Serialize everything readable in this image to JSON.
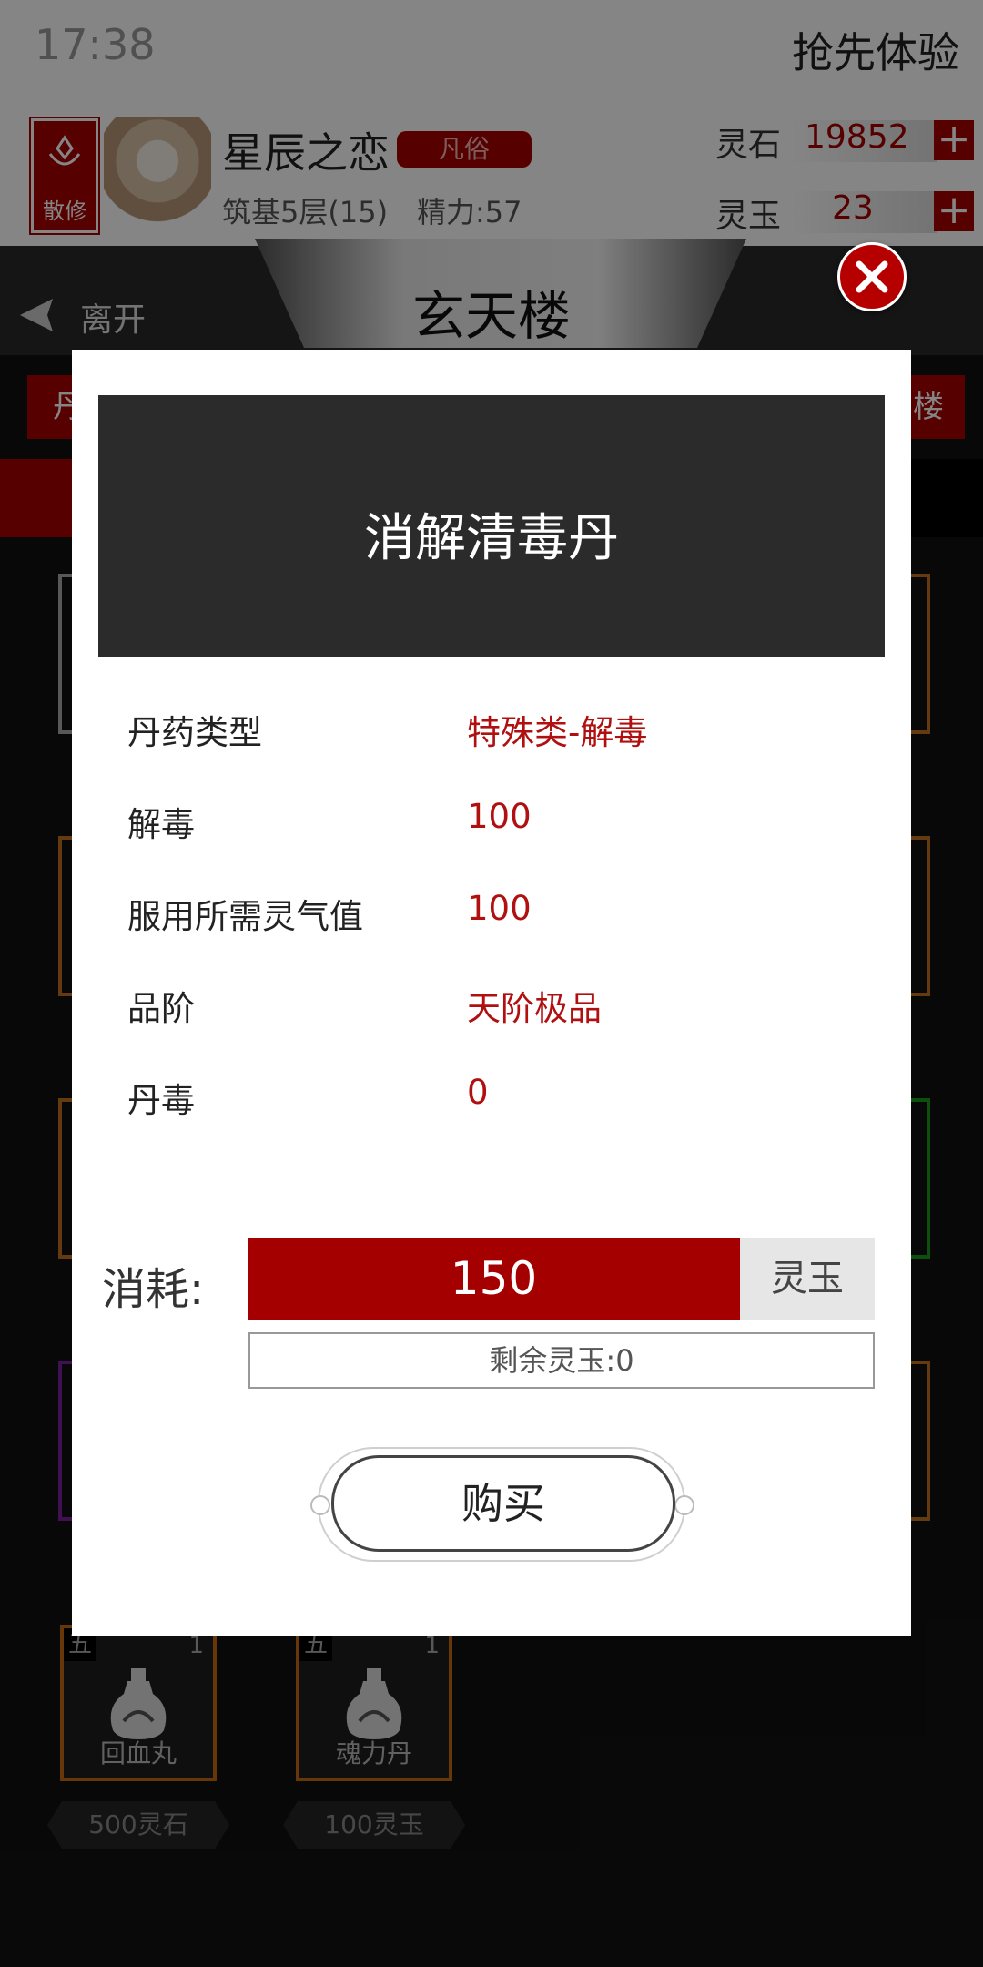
{
  "status": {
    "time": "17:38",
    "early_access": "抢先体验"
  },
  "player": {
    "sect_label": "散修",
    "name": "星辰之恋",
    "rank_tag": "凡俗",
    "realm": "筑基5层(15)",
    "energy": "精力:57"
  },
  "currency": [
    {
      "label": "灵石",
      "value": "19852"
    },
    {
      "label": "灵玉",
      "value": "23"
    }
  ],
  "hall": {
    "leave_label": "离开",
    "title": "玄天楼"
  },
  "tabs": {
    "left_partial": "丹",
    "right_partial": "楼"
  },
  "shop_items": [
    {
      "grade": "五",
      "count": "1",
      "name": "回血丸",
      "price": "500灵石"
    },
    {
      "grade": "五",
      "count": "1",
      "name": "魂力丹",
      "price": "100灵玉"
    }
  ],
  "modal": {
    "title": "消解清毒丹",
    "attributes": [
      {
        "label": "丹药类型",
        "value": "特殊类-解毒"
      },
      {
        "label": "解毒",
        "value": "100"
      },
      {
        "label": "服用所需灵气值",
        "value": "100"
      },
      {
        "label": "品阶",
        "value": "天阶极品"
      },
      {
        "label": "丹毒",
        "value": "0"
      }
    ],
    "cost_label": "消耗:",
    "cost_value": "150",
    "cost_unit": "灵玉",
    "remaining": "剩余灵玉:0",
    "buy_label": "购买"
  },
  "colors": {
    "accent": "#a50000",
    "value_text": "#b01010",
    "header_bg": "#2b2b2b"
  },
  "icons": {
    "close": "close-icon",
    "leave": "back-arrow-icon",
    "bottle": "potion-bottle-icon",
    "plus": "plus-icon"
  }
}
